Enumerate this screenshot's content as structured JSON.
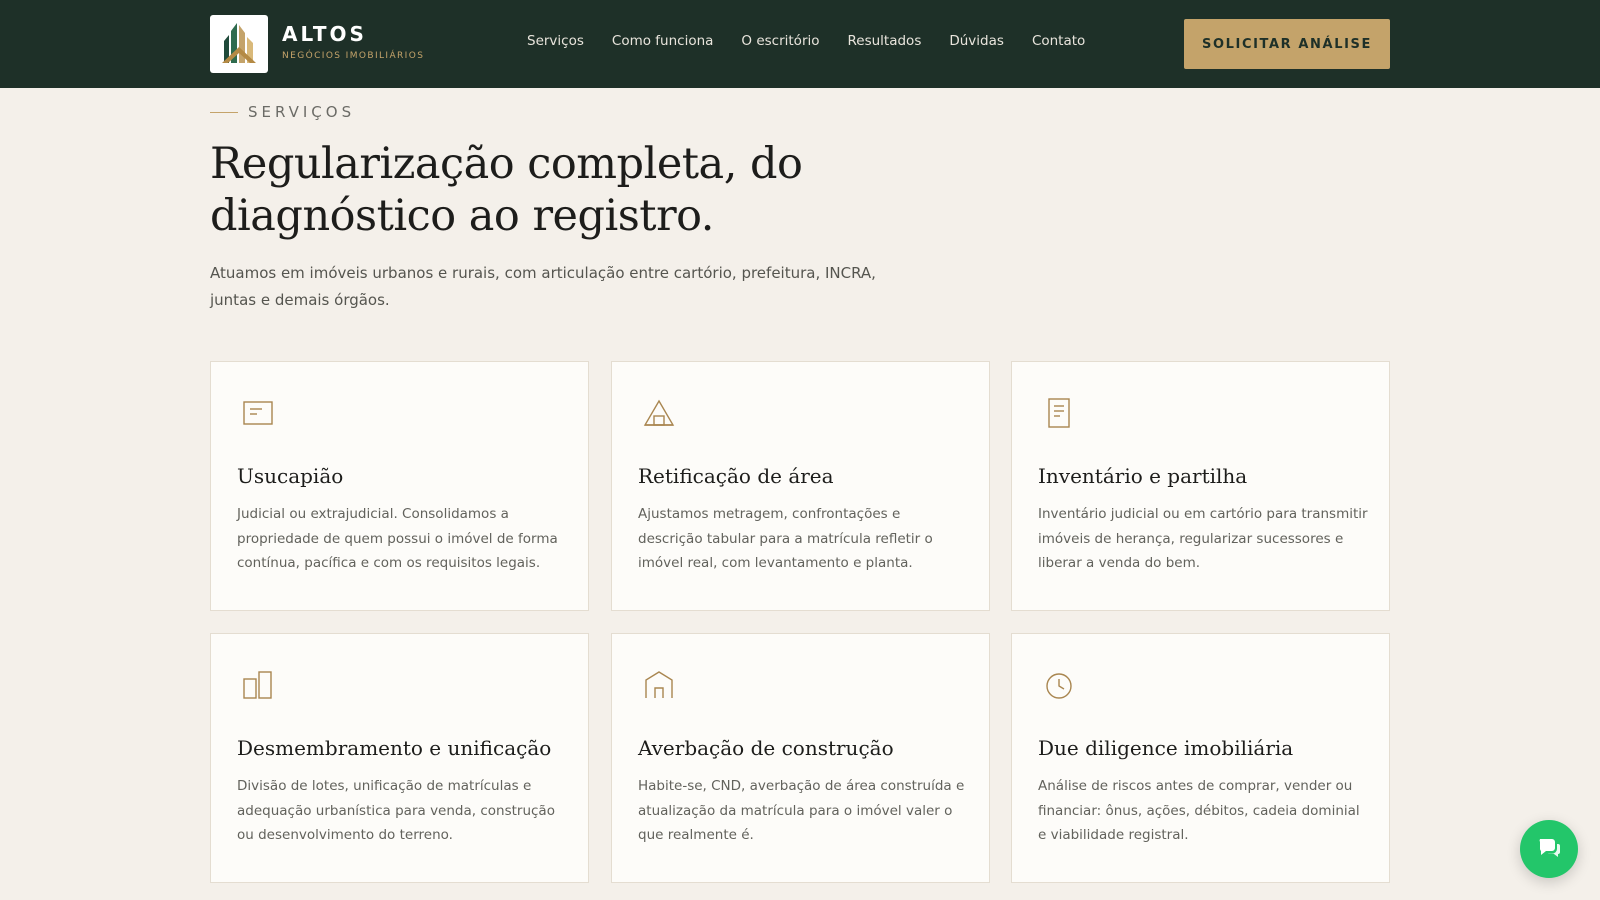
{
  "brand": {
    "name": "ALTOS",
    "tagline": "NEGÓCIOS IMOBILIÁRIOS",
    "logo_icon": "building-logo-icon"
  },
  "nav": [
    "Serviços",
    "Como funciona",
    "O escritório",
    "Resultados",
    "Dúvidas",
    "Contato"
  ],
  "cta_label": "SOLICITAR ANÁLISE",
  "section": {
    "eyebrow": "SERVIÇOS",
    "title": "Regularização completa, do diagnóstico ao registro.",
    "lead": "Atuamos em imóveis urbanos e rurais, com articulação entre cartório, prefeitura, INCRA, juntas e demais órgãos."
  },
  "cards": [
    {
      "icon": "document-lines-icon",
      "title": "Usucapião",
      "desc": "Judicial ou extrajudicial. Consolidamos a propriedade de quem possui o imóvel de forma contínua, pacífica e com os requisitos legais."
    },
    {
      "icon": "land-survey-icon",
      "title": "Retificação de área",
      "desc": "Ajustamos metragem, confrontações e descrição tabular para a matrícula refletir o imóvel real, com levantamento e planta."
    },
    {
      "icon": "file-icon",
      "title": "Inventário e partilha",
      "desc": "Inventário judicial ou em cartório para transmitir imóveis de herança, regularizar sucessores e liberar a venda do bem."
    },
    {
      "icon": "lots-icon",
      "title": "Desmembramento e unificação",
      "desc": "Divisão de lotes, unificação de matrículas e adequação urbanística para venda, construção ou desenvolvimento do terreno."
    },
    {
      "icon": "house-icon",
      "title": "Averbação de construção",
      "desc": "Habite-se, CND, averbação de área construída e atualização da matrícula para o imóvel valer o que realmente é."
    },
    {
      "icon": "clock-icon",
      "title": "Due diligence imobiliária",
      "desc": "Análise de riscos antes de comprar, vender ou financiar: ônus, ações, débitos, cadeia dominial e viabilidade registral."
    }
  ],
  "chat_icon": "chat-icon",
  "colors": {
    "header_bg": "#1e3028",
    "accent_gold": "#c4a36a",
    "page_bg": "#f4f0ea",
    "chat_green": "#23c66a"
  }
}
